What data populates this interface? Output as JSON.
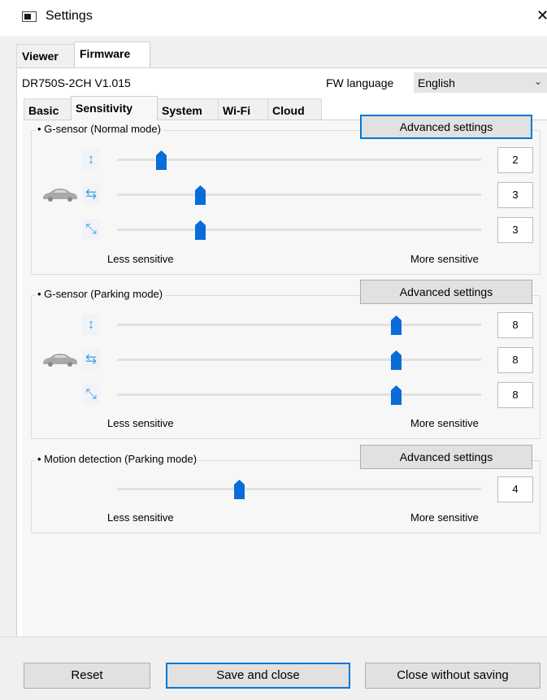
{
  "window": {
    "title": "Settings",
    "close_symbol": "✕"
  },
  "top_tabs": [
    {
      "label": "Viewer"
    },
    {
      "label": "Firmware"
    }
  ],
  "firmware": {
    "model": "DR750S-2CH V1.015",
    "fw_language_label": "FW language",
    "fw_language_value": "English"
  },
  "sub_tabs": [
    {
      "label": "Basic"
    },
    {
      "label": "Sensitivity"
    },
    {
      "label": "System"
    },
    {
      "label": "Wi-Fi"
    },
    {
      "label": "Cloud"
    }
  ],
  "labels": {
    "less": "Less sensitive",
    "more": "More sensitive",
    "advanced": "Advanced settings"
  },
  "groups": {
    "normal": {
      "title": "• G-sensor (Normal mode)",
      "rows": [
        {
          "icon": "vertical-axis-icon",
          "value": "2"
        },
        {
          "icon": "horizontal-axis-icon",
          "value": "3"
        },
        {
          "icon": "diagonal-axis-icon",
          "value": "3"
        }
      ]
    },
    "parking": {
      "title": "• G-sensor (Parking mode)",
      "rows": [
        {
          "icon": "vertical-axis-icon",
          "value": "8"
        },
        {
          "icon": "horizontal-axis-icon",
          "value": "8"
        },
        {
          "icon": "diagonal-axis-icon",
          "value": "8"
        }
      ]
    },
    "motion": {
      "title": "• Motion detection (Parking mode)",
      "rows": [
        {
          "value": "4"
        }
      ]
    }
  },
  "slider_range": {
    "min": 1,
    "max": 10
  },
  "buttons": {
    "reset": "Reset",
    "save": "Save and close",
    "close_nosave": "Close without saving"
  },
  "colors": {
    "accent": "#0078d7",
    "thumb": "#0a6cd8",
    "icon": "#4aa3e8"
  }
}
